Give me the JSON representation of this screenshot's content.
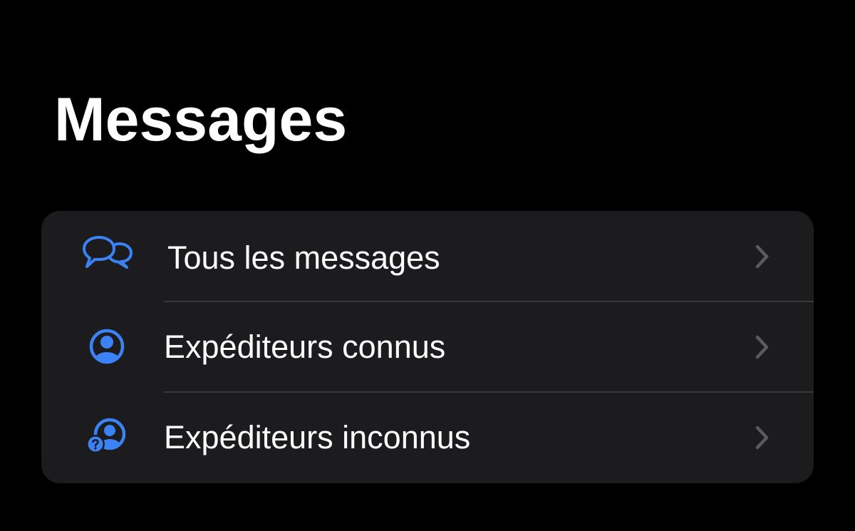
{
  "page": {
    "title": "Messages"
  },
  "filters": {
    "items": [
      {
        "label": "Tous les messages",
        "icon": "speech-bubbles-icon"
      },
      {
        "label": "Expéditeurs connus",
        "icon": "person-circle-icon"
      },
      {
        "label": "Expéditeurs inconnus",
        "icon": "person-question-icon"
      }
    ]
  },
  "colors": {
    "background": "#000000",
    "card": "#1c1c1e",
    "accent": "#3b82f6",
    "separator": "#38383a",
    "chevron": "#5a5a5f",
    "text": "#ffffff"
  }
}
